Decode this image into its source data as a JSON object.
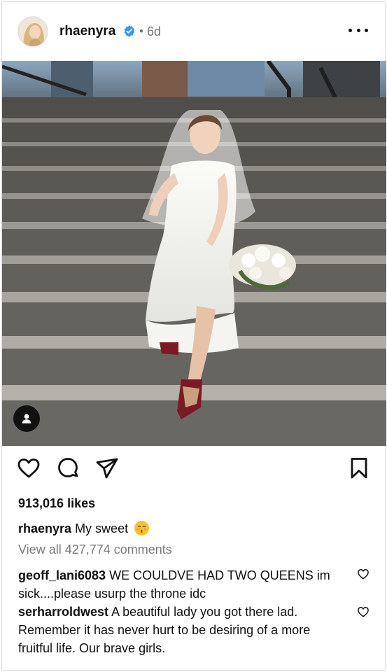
{
  "post": {
    "username": "rhaenyra",
    "separator": "•",
    "time": "6d",
    "likes": "913,016 likes",
    "caption_user": "rhaenyra",
    "caption_text": "My sweet",
    "caption_emoji": "kissing-face-emoji",
    "view_all": "View all 427,774 comments"
  },
  "comments": [
    {
      "user": "geoff_lani6083",
      "text": "WE COULDVE HAD TWO QUEENS im sick....please usurp the throne idc"
    },
    {
      "user": "serharroldwest",
      "text": "A beautiful lady you got there lad. Remember it has never hurt to be desiring of a more fruitful life. Our brave girls."
    }
  ],
  "icons": {
    "verified": "verified-badge-icon",
    "more": "more-options-icon",
    "like": "heart-icon",
    "comment": "comment-icon",
    "share": "paper-plane-icon",
    "save": "bookmark-icon",
    "tag": "user-tag-icon"
  },
  "colors": {
    "verified_blue": "#3797f0",
    "muted_text": "#7a7a7a"
  }
}
